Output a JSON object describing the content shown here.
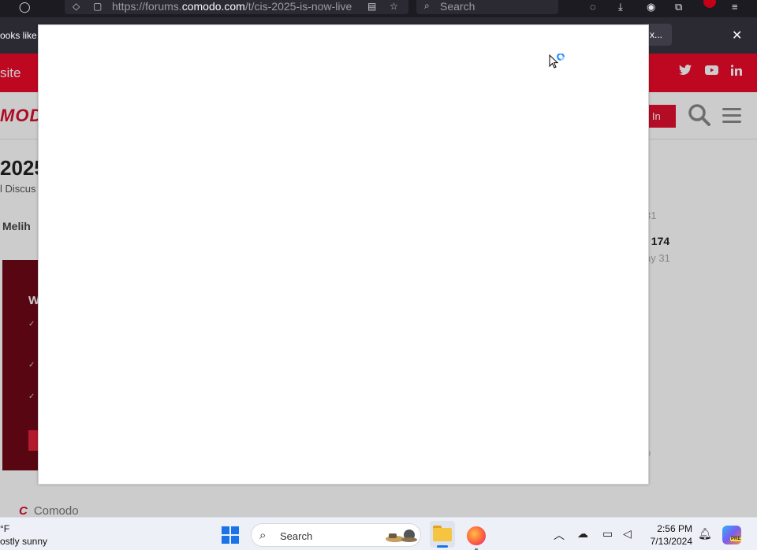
{
  "browser": {
    "url_prefix": "https://forums.",
    "url_domain": "comodo.com",
    "url_path": "/t/cis-2025-is-now-live",
    "search_placeholder": "Search",
    "notification_text": "ooks like y",
    "notification_button": "x...",
    "notification_close": "✕"
  },
  "site": {
    "top_link": "site",
    "logo_text": "MODO",
    "login_label": "g In",
    "social": [
      "twitter-icon",
      "youtube-icon",
      "linkedin-icon"
    ]
  },
  "topic": {
    "title": "2025",
    "category": "l Discus",
    "author": "Melih",
    "date1": "31",
    "count": "/ 174",
    "date2": "ay 31",
    "date3": "o"
  },
  "promo": {
    "heading": "W",
    "checks": [
      "✓",
      "✓",
      "✓"
    ]
  },
  "footer": {
    "brand_mark": "C",
    "brand": "Comodo"
  },
  "taskbar": {
    "weather_temp": "°F",
    "weather_condition": "ostly sunny",
    "search_label": "Search",
    "time": "2:56 PM",
    "date": "7/13/2024",
    "copilot_badge": "PRE"
  },
  "colors": {
    "brand_red": "#ee0a2b",
    "browser_dark": "#1c1b22",
    "taskbar_bg": "#eef0f7"
  }
}
